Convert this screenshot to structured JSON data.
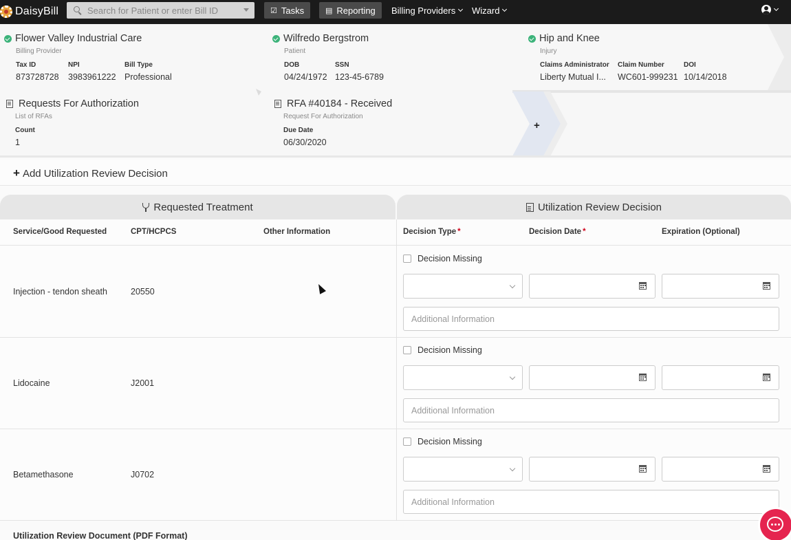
{
  "app": {
    "name": "DaisyBill"
  },
  "search": {
    "placeholder": "Search for Patient or enter Bill ID"
  },
  "nav": {
    "tasks": "Tasks",
    "reporting": "Reporting",
    "billing_providers": "Billing Providers",
    "wizard": "Wizard"
  },
  "crumbs": {
    "provider": {
      "title": "Flower Valley Industrial Care",
      "subtitle": "Billing Provider",
      "fields": [
        {
          "label": "Tax ID",
          "value": "873728728"
        },
        {
          "label": "NPI",
          "value": "3983961222"
        },
        {
          "label": "Bill Type",
          "value": "Professional"
        }
      ]
    },
    "patient": {
      "title": "Wilfredo Bergstrom",
      "subtitle": "Patient",
      "fields": [
        {
          "label": "DOB",
          "value": "04/24/1972"
        },
        {
          "label": "SSN",
          "value": "123-45-6789"
        }
      ]
    },
    "injury": {
      "title": "Hip and Knee",
      "subtitle": "Injury",
      "fields": [
        {
          "label": "Claims Administrator",
          "value": "Liberty Mutual I..."
        },
        {
          "label": "Claim Number",
          "value": "WC601-999231"
        },
        {
          "label": "DOI",
          "value": "10/14/2018"
        }
      ]
    },
    "rfas": {
      "title": "Requests For Authorization",
      "subtitle": "List of RFAs",
      "fields": [
        {
          "label": "Count",
          "value": "1"
        }
      ]
    },
    "rfa": {
      "title": "RFA #40184 - Received",
      "subtitle": "Request For Authorization",
      "fields": [
        {
          "label": "Due Date",
          "value": "06/30/2020"
        }
      ]
    },
    "add_symbol": "+"
  },
  "add_ur": {
    "title": "Add Utilization Review Decision"
  },
  "sections": {
    "requested": "Requested Treatment",
    "ur_decision": "Utilization Review Decision"
  },
  "columns": {
    "service": "Service/Good Requested",
    "cpt": "CPT/HCPCS",
    "other": "Other Information",
    "decision_type": "Decision Type",
    "decision_date": "Decision Date",
    "expiration": "Expiration (Optional)",
    "required_mark": "*"
  },
  "rows": [
    {
      "service": "Injection - tendon sheath",
      "cpt": "20550",
      "other": ""
    },
    {
      "service": "Lidocaine",
      "cpt": "J2001",
      "other": ""
    },
    {
      "service": "Betamethasone",
      "cpt": "J0702",
      "other": ""
    }
  ],
  "row_controls": {
    "decision_missing": "Decision Missing",
    "additional_info_placeholder": "Additional Information"
  },
  "ur_document": {
    "label": "Utilization Review Document (PDF Format)"
  },
  "colors": {
    "topbar": "#1b1b1b",
    "check": "#3cb37a",
    "chat": "#e5244f",
    "required": "#d0021b"
  }
}
